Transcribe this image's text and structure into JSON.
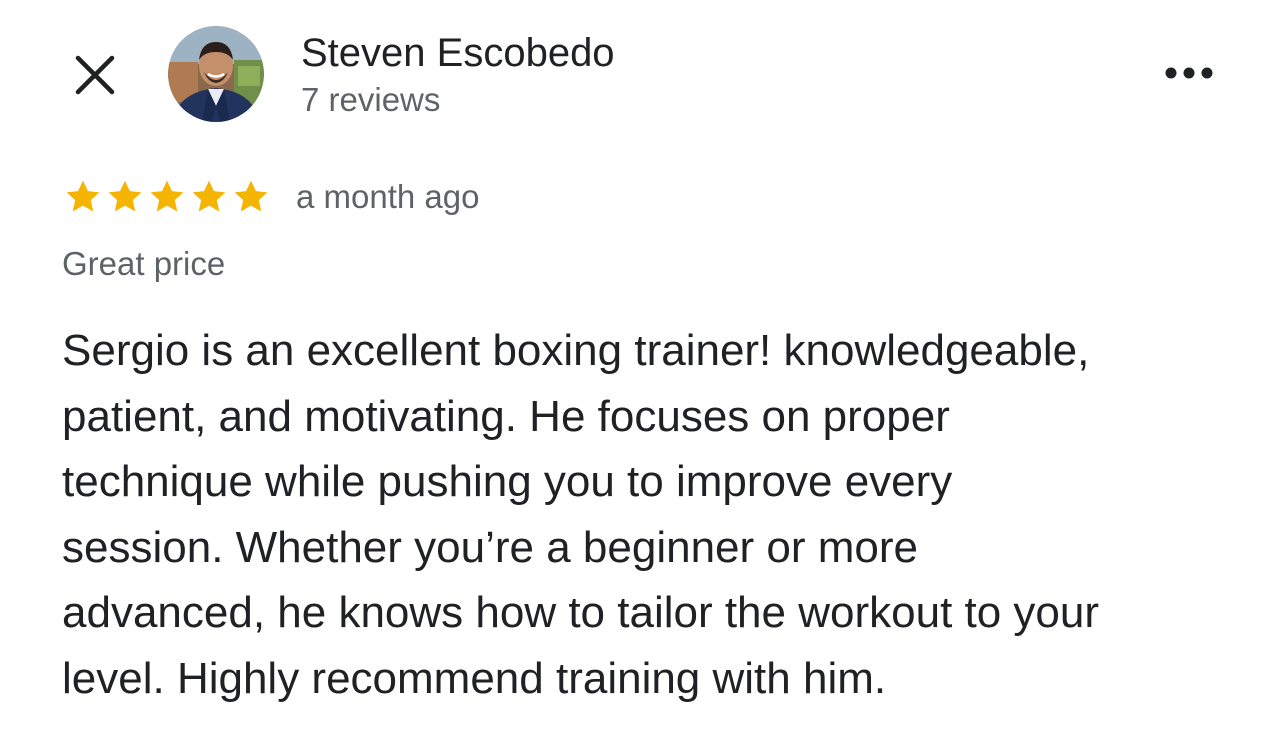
{
  "header": {
    "author_name": "Steven Escobedo",
    "review_count": "7 reviews",
    "close_icon": "close-icon",
    "more_icon": "more-horizontal-icon"
  },
  "review": {
    "rating": 5,
    "rating_max": 5,
    "date": "a month ago",
    "tag": "Great price",
    "text_lines": [
      "Sergio is an excellent boxing trainer! knowledgeable,",
      "patient, and motivating. He focuses on proper",
      "technique while pushing you to improve every",
      "session. Whether you’re a beginner or more",
      "advanced, he knows how to tailor the workout to your",
      "level. Highly recommend training with him."
    ]
  },
  "colors": {
    "star": "#F4B400",
    "primary_text": "#202124",
    "secondary_text": "#5F6368",
    "background": "#FFFFFF"
  }
}
